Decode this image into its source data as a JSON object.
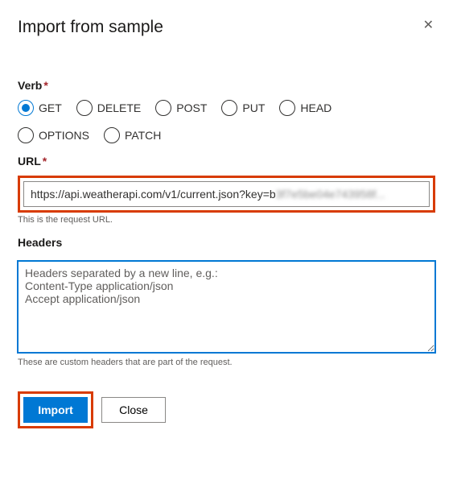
{
  "dialog": {
    "title": "Import from sample"
  },
  "verb": {
    "label": "Verb",
    "options": {
      "get": "GET",
      "delete": "DELETE",
      "post": "POST",
      "put": "PUT",
      "head": "HEAD",
      "options": "OPTIONS",
      "patch": "PATCH"
    },
    "selected": "GET"
  },
  "url": {
    "label": "URL",
    "value_visible": "https://api.weatherapi.com/v1/current.json?key=b",
    "value_obscured": "3f7e5be04e743958f...",
    "helper": "This is the request URL."
  },
  "headers": {
    "label": "Headers",
    "placeholder": "Headers separated by a new line, e.g.:\nContent-Type application/json\nAccept application/json",
    "helper": "These are custom headers that are part of the request."
  },
  "buttons": {
    "import": "Import",
    "close": "Close"
  }
}
